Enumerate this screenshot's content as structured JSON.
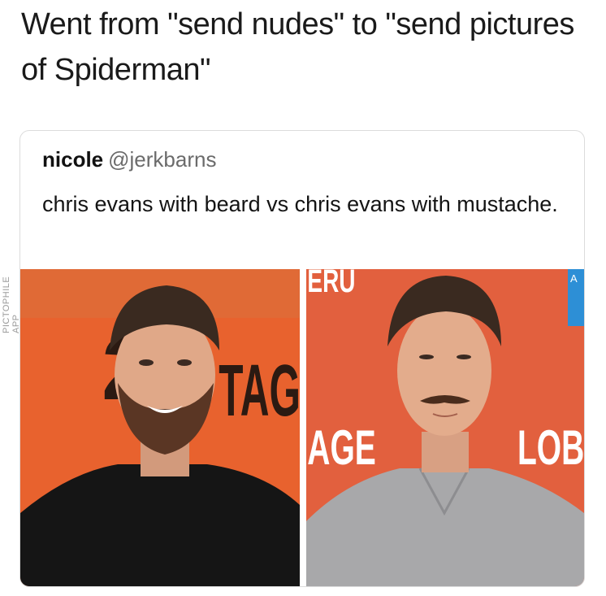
{
  "caption": "Went from \"send nudes\" to \"send pictures of Spiderman\"",
  "watermark": "PICTOPHILE APP",
  "tweet": {
    "name": "nicole",
    "handle": "@jerkbarns",
    "text": "chris evans with beard vs chris evans with mustache."
  },
  "photos": {
    "left": {
      "backdrop_text_main": "TAG",
      "backdrop_text_edge": "2"
    },
    "right": {
      "backdrop_text_top": "ERU",
      "backdrop_text_mid": "AGE",
      "backdrop_text_side": "LOBE",
      "backdrop_text_corner": "A"
    }
  },
  "colors": {
    "backdrop_orange": "#e8622e",
    "backdrop_right": "#e2603e",
    "shirt_black": "#151515",
    "shirt_gray": "#a8a8aa",
    "hair": "#3a2a20",
    "skin": "#e0a888"
  }
}
